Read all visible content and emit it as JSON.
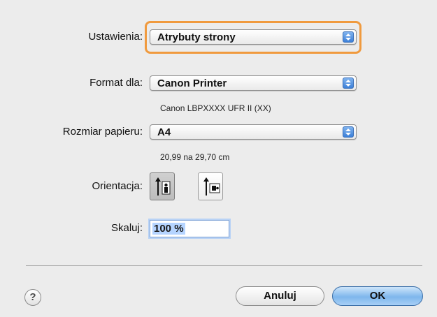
{
  "settings": {
    "label": "Ustawienia:",
    "value": "Atrybuty strony"
  },
  "format_for": {
    "label": "Format dla:",
    "value": "Canon Printer",
    "info": "Canon LBPXXXX UFR II (XX)"
  },
  "paper_size": {
    "label": "Rozmiar papieru:",
    "value": "A4",
    "info": "20,99 na 29,70 cm"
  },
  "orientation": {
    "label": "Orientacja:",
    "selected": "portrait",
    "options": [
      "portrait",
      "landscape"
    ]
  },
  "scale": {
    "label": "Skaluj:",
    "value": "100 %"
  },
  "buttons": {
    "help": "?",
    "cancel": "Anuluj",
    "ok": "OK"
  },
  "colors": {
    "focus_ring": "#f09a3e",
    "default_button": "#7eb6ec",
    "stepper": "#3d80d8"
  }
}
